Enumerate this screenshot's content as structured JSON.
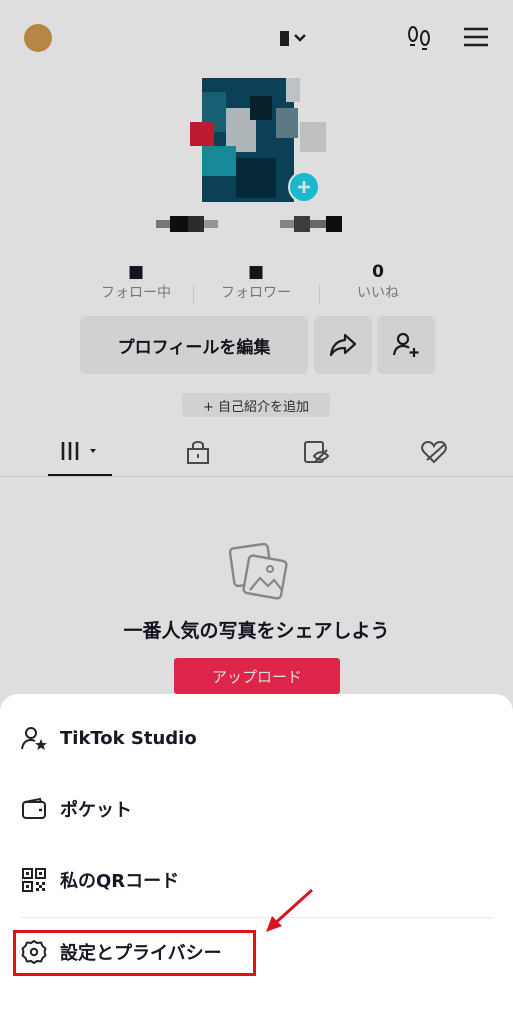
{
  "profile": {
    "stats": [
      {
        "value": "■",
        "label": "フォロー中"
      },
      {
        "value": "■",
        "label": "フォロワー"
      },
      {
        "value": "0",
        "label": "いいね"
      }
    ],
    "edit_profile_label": "プロフィールを編集",
    "add_bio_label": "+ 自己紹介を追加"
  },
  "empty_state": {
    "title": "一番人気の写真をシェアしよう",
    "upload_label": "アップロード"
  },
  "menu": {
    "items": [
      {
        "label": "TikTok Studio",
        "icon": "person-star-icon"
      },
      {
        "label": "ポケット",
        "icon": "wallet-icon"
      },
      {
        "label": "私のQRコード",
        "icon": "qr-code-icon"
      },
      {
        "label": "設定とプライバシー",
        "icon": "gear-icon"
      }
    ]
  },
  "colors": {
    "accent": "#fe2c55",
    "highlight_box": "#d9141d",
    "annotation_arrow": "#d9141d"
  }
}
